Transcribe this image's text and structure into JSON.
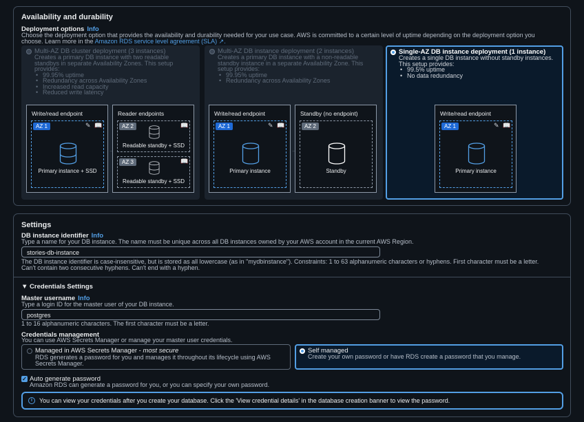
{
  "availability": {
    "title": "Availability and durability",
    "deployment_label": "Deployment options",
    "info": "Info",
    "desc_line1": "Choose the deployment option that provides the availability and durability needed for your use case. AWS is committed to a certain level of uptime depending on the deployment option you",
    "desc_line2_prefix": "choose. Learn more in the ",
    "sla_link": "Amazon RDS service level agreement (SLA)",
    "options": [
      {
        "title": "Multi-AZ DB cluster deployment (3 instances)",
        "lines": [
          "Creates a primary DB instance with two readable",
          "standbys in separate Availability Zones. This setup",
          "provides:"
        ],
        "bullets": [
          "99.95% uptime",
          "Redundancy across Availability Zones",
          "Increased read capacity",
          "Reduced write latency"
        ],
        "selected": false
      },
      {
        "title": "Multi-AZ DB instance deployment (2 instances)",
        "lines": [
          "Creates a primary DB instance with a non-readable",
          "standby instance in a separate Availability Zone. This",
          "setup provides:"
        ],
        "bullets": [
          "99.95% uptime",
          "Redundancy across Availability Zones"
        ],
        "selected": false
      },
      {
        "title": "Single-AZ DB instance deployment (1 instance)",
        "lines": [
          "Creates a single DB instance without standby instances.",
          "This setup provides:"
        ],
        "bullets": [
          "99.5% uptime",
          "No data redundancy"
        ],
        "selected": true
      }
    ],
    "diagram": {
      "write_read_endpoint": "Write/read endpoint",
      "reader_endpoints": "Reader endpoints",
      "standby_no_endpoint": "Standby (no endpoint)",
      "az1": "AZ 1",
      "az2": "AZ 2",
      "az3": "AZ 3",
      "primary_ssd": "Primary instance + SSD",
      "readable_standby_ssd": "Readable standby + SSD",
      "primary": "Primary instance",
      "standby": "Standby"
    }
  },
  "settings": {
    "title": "Settings",
    "identifier_label": "DB instance identifier",
    "info": "Info",
    "identifier_desc": "Type a name for your DB instance. The name must be unique across all DB instances owned by your AWS account in the current AWS Region.",
    "identifier_value": "stories-db-instance",
    "identifier_hint1": "The DB instance identifier is case-insensitive, but is stored as all lowercase (as in \"mydbinstance\"). Constraints: 1 to 63 alphanumeric characters or hyphens. First character must be a letter.",
    "identifier_hint2": "Can't contain two consecutive hyphens. Can't end with a hyphen.",
    "credentials_settings": "Credentials Settings",
    "master_label": "Master username",
    "master_desc": "Type a login ID for the master user of your DB instance.",
    "master_value": "postgres",
    "master_hint": "1 to 16 alphanumeric characters. The first character must be a letter.",
    "cred_mgmt_label": "Credentials management",
    "cred_mgmt_desc": "You can use AWS Secrets Manager or manage your master user credentials.",
    "managed_title": "Managed in AWS Secrets Manager - ",
    "managed_em": "most secure",
    "managed_desc1": "RDS generates a password for you and manages it throughout its lifecycle using AWS",
    "managed_desc2": "Secrets Manager.",
    "self_title": "Self managed",
    "self_desc": "Create your own password or have RDS create a password that you manage.",
    "auto_gen_label": "Auto generate password",
    "auto_gen_desc": "Amazon RDS can generate a password for you, or you can specify your own password.",
    "note": "You can view your credentials after you create your database. Click the 'View credential details' in the database creation banner to view the password."
  }
}
